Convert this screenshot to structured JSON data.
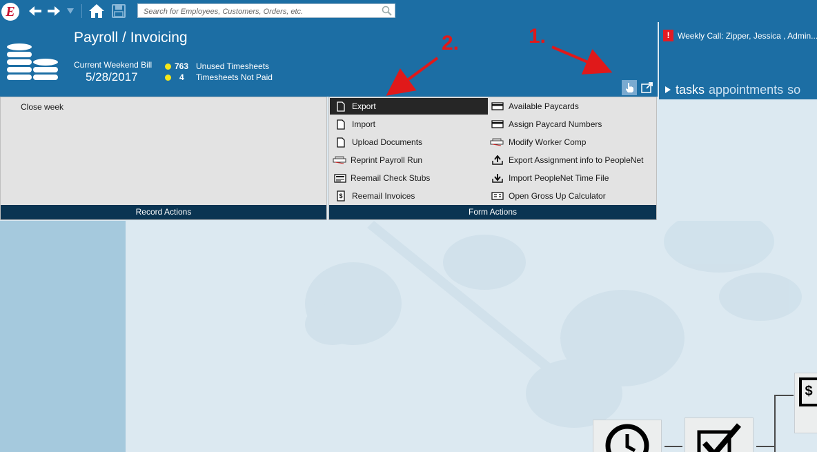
{
  "toolbar": {
    "logo_letter": "E",
    "search_placeholder": "Search for Employees, Customers, Orders, etc."
  },
  "header": {
    "title": "Payroll / Invoicing",
    "bill_label": "Current Weekend Bill",
    "bill_date": "5/28/2017",
    "stats": [
      {
        "count": "763",
        "label": "Unused Timesheets"
      },
      {
        "count": "4",
        "label": "Timesheets Not Paid"
      }
    ]
  },
  "right_panel": {
    "alert_icon": "!",
    "alert_text": "Weekly Call: Zipper, Jessica , Admin....",
    "tabs": [
      "tasks",
      "appointments",
      "so"
    ]
  },
  "record_actions": {
    "footer": "Record Actions",
    "items": [
      "Close week"
    ]
  },
  "form_actions": {
    "footer": "Form Actions",
    "left_items": [
      {
        "label": "Export",
        "icon": "document-icon",
        "selected": true
      },
      {
        "label": "Import",
        "icon": "document-icon"
      },
      {
        "label": "Upload Documents",
        "icon": "document-icon"
      },
      {
        "label": "Reprint Payroll Run",
        "icon": "printer-icon"
      },
      {
        "label": "Reemail Check Stubs",
        "icon": "check-stub-icon"
      },
      {
        "label": "Reemail Invoices",
        "icon": "invoice-icon"
      }
    ],
    "right_items": [
      {
        "label": "Available Paycards",
        "icon": "card-icon"
      },
      {
        "label": "Assign Paycard Numbers",
        "icon": "card-icon"
      },
      {
        "label": "Modify Worker Comp",
        "icon": "printer-icon"
      },
      {
        "label": "Export Assignment info to PeopleNet",
        "icon": "upload-tray-icon"
      },
      {
        "label": "Import PeopleNet Time File",
        "icon": "download-tray-icon"
      },
      {
        "label": "Open Gross Up Calculator",
        "icon": "calculator-icon"
      }
    ]
  },
  "annotations": {
    "label_1": "1.",
    "label_2": "2."
  },
  "colors": {
    "header_blue": "#1c6ea4",
    "footer_navy": "#0a3452",
    "annotation_red": "#e0191a",
    "stat_dot": "#f5e71a"
  }
}
